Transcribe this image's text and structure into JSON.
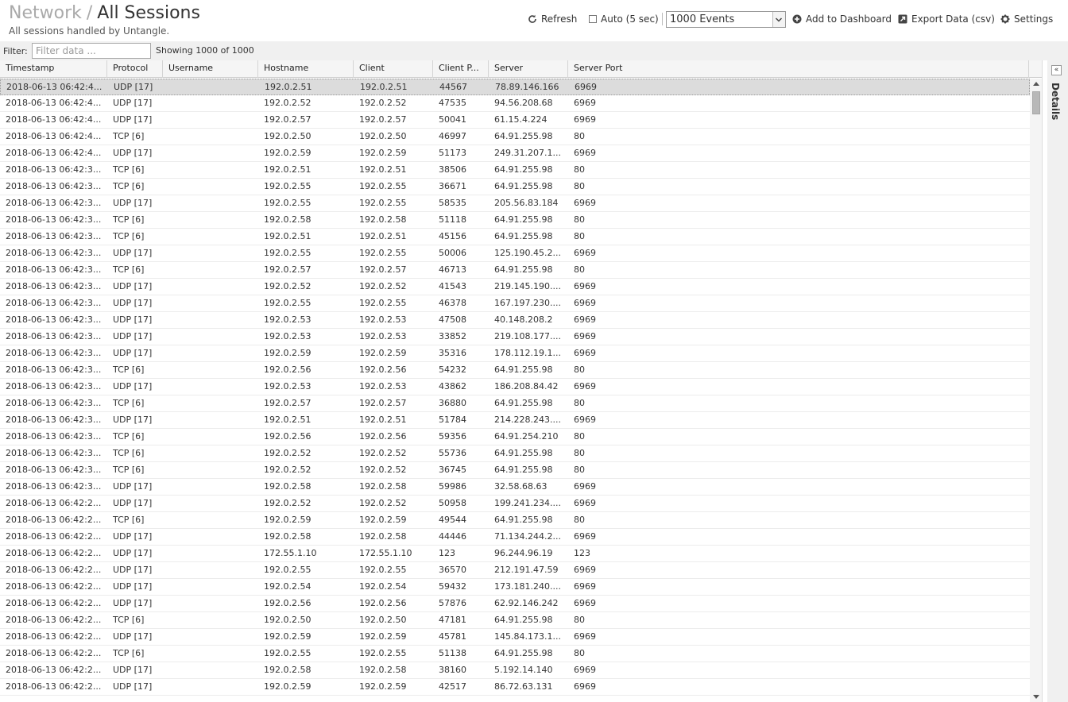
{
  "header": {
    "breadcrumb_parent": "Network",
    "separator": "/",
    "title": "All Sessions",
    "subtitle": "All sessions handled by Untangle."
  },
  "toolbar": {
    "refresh_label": "Refresh",
    "auto_label": "Auto (5 sec)",
    "auto_checked": false,
    "events_select_value": "1000 Events",
    "add_dashboard_label": "Add to Dashboard",
    "export_label": "Export Data (csv)",
    "settings_label": "Settings"
  },
  "filter": {
    "label": "Filter:",
    "placeholder": "Filter data ...",
    "showing": "Showing 1000 of 1000"
  },
  "grid": {
    "columns": [
      "Timestamp",
      "Protocol",
      "Username",
      "Hostname",
      "Client",
      "Client P...",
      "Server",
      "Server Port"
    ],
    "rows": [
      [
        "2018-06-13 06:42:4...",
        "UDP [17]",
        "",
        "192.0.2.51",
        "192.0.2.51",
        "44567",
        "78.89.146.166",
        "6969"
      ],
      [
        "2018-06-13 06:42:4...",
        "UDP [17]",
        "",
        "192.0.2.52",
        "192.0.2.52",
        "47535",
        "94.56.208.68",
        "6969"
      ],
      [
        "2018-06-13 06:42:4...",
        "UDP [17]",
        "",
        "192.0.2.57",
        "192.0.2.57",
        "50041",
        "61.15.4.224",
        "6969"
      ],
      [
        "2018-06-13 06:42:4...",
        "TCP [6]",
        "",
        "192.0.2.50",
        "192.0.2.50",
        "46997",
        "64.91.255.98",
        "80"
      ],
      [
        "2018-06-13 06:42:4...",
        "UDP [17]",
        "",
        "192.0.2.59",
        "192.0.2.59",
        "51173",
        "249.31.207.1...",
        "6969"
      ],
      [
        "2018-06-13 06:42:3...",
        "TCP [6]",
        "",
        "192.0.2.51",
        "192.0.2.51",
        "38506",
        "64.91.255.98",
        "80"
      ],
      [
        "2018-06-13 06:42:3...",
        "TCP [6]",
        "",
        "192.0.2.55",
        "192.0.2.55",
        "36671",
        "64.91.255.98",
        "80"
      ],
      [
        "2018-06-13 06:42:3...",
        "UDP [17]",
        "",
        "192.0.2.55",
        "192.0.2.55",
        "58535",
        "205.56.83.184",
        "6969"
      ],
      [
        "2018-06-13 06:42:3...",
        "TCP [6]",
        "",
        "192.0.2.58",
        "192.0.2.58",
        "51118",
        "64.91.255.98",
        "80"
      ],
      [
        "2018-06-13 06:42:3...",
        "TCP [6]",
        "",
        "192.0.2.51",
        "192.0.2.51",
        "45156",
        "64.91.255.98",
        "80"
      ],
      [
        "2018-06-13 06:42:3...",
        "UDP [17]",
        "",
        "192.0.2.55",
        "192.0.2.55",
        "50006",
        "125.190.45.2...",
        "6969"
      ],
      [
        "2018-06-13 06:42:3...",
        "TCP [6]",
        "",
        "192.0.2.57",
        "192.0.2.57",
        "46713",
        "64.91.255.98",
        "80"
      ],
      [
        "2018-06-13 06:42:3...",
        "UDP [17]",
        "",
        "192.0.2.52",
        "192.0.2.52",
        "41543",
        "219.145.190....",
        "6969"
      ],
      [
        "2018-06-13 06:42:3...",
        "UDP [17]",
        "",
        "192.0.2.55",
        "192.0.2.55",
        "46378",
        "167.197.230....",
        "6969"
      ],
      [
        "2018-06-13 06:42:3...",
        "UDP [17]",
        "",
        "192.0.2.53",
        "192.0.2.53",
        "47508",
        "40.148.208.2",
        "6969"
      ],
      [
        "2018-06-13 06:42:3...",
        "UDP [17]",
        "",
        "192.0.2.53",
        "192.0.2.53",
        "33852",
        "219.108.177....",
        "6969"
      ],
      [
        "2018-06-13 06:42:3...",
        "UDP [17]",
        "",
        "192.0.2.59",
        "192.0.2.59",
        "35316",
        "178.112.19.1...",
        "6969"
      ],
      [
        "2018-06-13 06:42:3...",
        "TCP [6]",
        "",
        "192.0.2.56",
        "192.0.2.56",
        "54232",
        "64.91.255.98",
        "80"
      ],
      [
        "2018-06-13 06:42:3...",
        "UDP [17]",
        "",
        "192.0.2.53",
        "192.0.2.53",
        "43862",
        "186.208.84.42",
        "6969"
      ],
      [
        "2018-06-13 06:42:3...",
        "TCP [6]",
        "",
        "192.0.2.57",
        "192.0.2.57",
        "36880",
        "64.91.255.98",
        "80"
      ],
      [
        "2018-06-13 06:42:3...",
        "UDP [17]",
        "",
        "192.0.2.51",
        "192.0.2.51",
        "51784",
        "214.228.243....",
        "6969"
      ],
      [
        "2018-06-13 06:42:3...",
        "TCP [6]",
        "",
        "192.0.2.56",
        "192.0.2.56",
        "59356",
        "64.91.254.210",
        "80"
      ],
      [
        "2018-06-13 06:42:3...",
        "TCP [6]",
        "",
        "192.0.2.52",
        "192.0.2.52",
        "55736",
        "64.91.255.98",
        "80"
      ],
      [
        "2018-06-13 06:42:3...",
        "TCP [6]",
        "",
        "192.0.2.52",
        "192.0.2.52",
        "36745",
        "64.91.255.98",
        "80"
      ],
      [
        "2018-06-13 06:42:3...",
        "UDP [17]",
        "",
        "192.0.2.58",
        "192.0.2.58",
        "59986",
        "32.58.68.63",
        "6969"
      ],
      [
        "2018-06-13 06:42:2...",
        "UDP [17]",
        "",
        "192.0.2.52",
        "192.0.2.52",
        "50958",
        "199.241.234....",
        "6969"
      ],
      [
        "2018-06-13 06:42:2...",
        "TCP [6]",
        "",
        "192.0.2.59",
        "192.0.2.59",
        "49544",
        "64.91.255.98",
        "80"
      ],
      [
        "2018-06-13 06:42:2...",
        "UDP [17]",
        "",
        "192.0.2.58",
        "192.0.2.58",
        "44446",
        "71.134.244.2...",
        "6969"
      ],
      [
        "2018-06-13 06:42:2...",
        "UDP [17]",
        "",
        "172.55.1.10",
        "172.55.1.10",
        "123",
        "96.244.96.19",
        "123"
      ],
      [
        "2018-06-13 06:42:2...",
        "UDP [17]",
        "",
        "192.0.2.55",
        "192.0.2.55",
        "36570",
        "212.191.47.59",
        "6969"
      ],
      [
        "2018-06-13 06:42:2...",
        "UDP [17]",
        "",
        "192.0.2.54",
        "192.0.2.54",
        "59432",
        "173.181.240....",
        "6969"
      ],
      [
        "2018-06-13 06:42:2...",
        "UDP [17]",
        "",
        "192.0.2.56",
        "192.0.2.56",
        "57876",
        "62.92.146.242",
        "6969"
      ],
      [
        "2018-06-13 06:42:2...",
        "TCP [6]",
        "",
        "192.0.2.50",
        "192.0.2.50",
        "47181",
        "64.91.255.98",
        "80"
      ],
      [
        "2018-06-13 06:42:2...",
        "UDP [17]",
        "",
        "192.0.2.59",
        "192.0.2.59",
        "45781",
        "145.84.173.1...",
        "6969"
      ],
      [
        "2018-06-13 06:42:2...",
        "TCP [6]",
        "",
        "192.0.2.55",
        "192.0.2.55",
        "51138",
        "64.91.255.98",
        "80"
      ],
      [
        "2018-06-13 06:42:2...",
        "UDP [17]",
        "",
        "192.0.2.58",
        "192.0.2.58",
        "38160",
        "5.192.14.140",
        "6969"
      ],
      [
        "2018-06-13 06:42:2...",
        "UDP [17]",
        "",
        "192.0.2.59",
        "192.0.2.59",
        "42517",
        "86.72.63.131",
        "6969"
      ]
    ]
  },
  "details_panel": {
    "label": "Details"
  },
  "icons": {
    "refresh": "refresh-icon",
    "add": "plus-circle-icon",
    "export": "export-icon",
    "settings": "gear-icon",
    "collapse": "double-chevron-left-icon"
  }
}
